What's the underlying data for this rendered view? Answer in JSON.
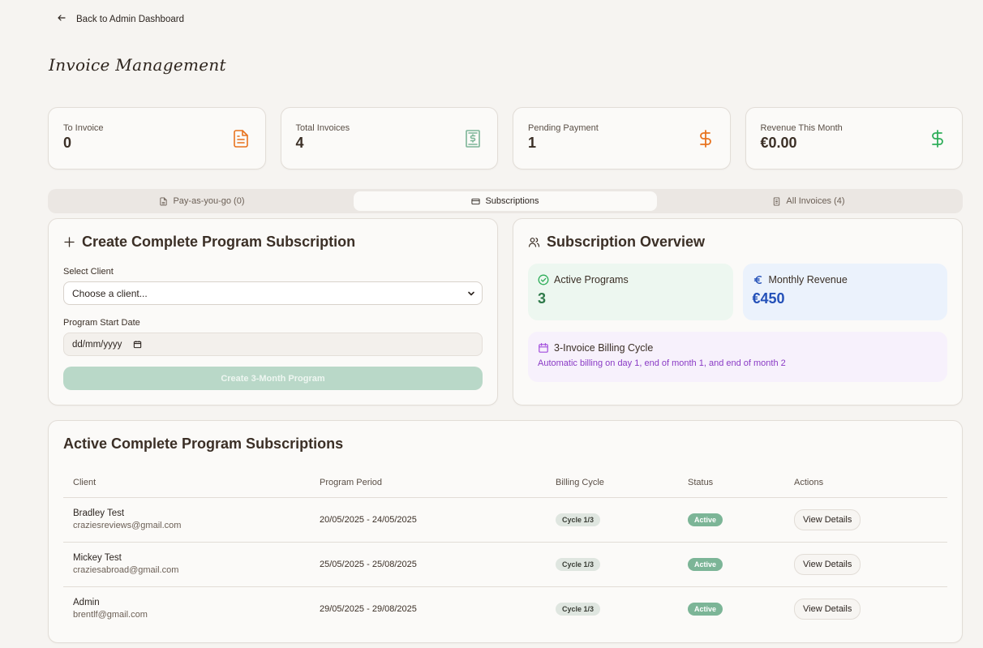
{
  "nav": {
    "back_label": "Back to Admin Dashboard"
  },
  "page": {
    "title": "Invoice Management"
  },
  "stats": [
    {
      "label": "To Invoice",
      "value": "0",
      "icon": "file-text-icon",
      "color": "#e8731e"
    },
    {
      "label": "Total Invoices",
      "value": "4",
      "icon": "receipt-icon",
      "color": "#7cb597"
    },
    {
      "label": "Pending Payment",
      "value": "1",
      "icon": "dollar-icon",
      "color": "#e8731e"
    },
    {
      "label": "Revenue This Month",
      "value": "€0.00",
      "icon": "dollar-icon",
      "color": "#2fae5a"
    }
  ],
  "tabs": [
    {
      "label": "Pay-as-you-go (0)",
      "active": false
    },
    {
      "label": "Subscriptions",
      "active": true
    },
    {
      "label": "All Invoices (4)",
      "active": false
    }
  ],
  "create_form": {
    "title": "Create Complete Program Subscription",
    "client_label": "Select Client",
    "client_placeholder": "Choose a client...",
    "date_label": "Program Start Date",
    "date_placeholder": "dd/mm/yyyy",
    "submit_label": "Create 3-Month Program"
  },
  "overview": {
    "title": "Subscription Overview",
    "active_programs_label": "Active Programs",
    "active_programs_value": "3",
    "monthly_revenue_label": "Monthly Revenue",
    "monthly_revenue_value": "€450",
    "billing_title": "3-Invoice Billing Cycle",
    "billing_desc": "Automatic billing on day 1, end of month 1, and end of month 2"
  },
  "subscriptions": {
    "title": "Active Complete Program Subscriptions",
    "columns": [
      "Client",
      "Program Period",
      "Billing Cycle",
      "Status",
      "Actions"
    ],
    "rows": [
      {
        "name": "Bradley Test",
        "email": "craziesreviews@gmail.com",
        "period": "20/05/2025 - 24/05/2025",
        "cycle": "Cycle 1/3",
        "status": "Active",
        "action": "View Details"
      },
      {
        "name": "Mickey Test",
        "email": "craziesabroad@gmail.com",
        "period": "25/05/2025 - 25/08/2025",
        "cycle": "Cycle 1/3",
        "status": "Active",
        "action": "View Details"
      },
      {
        "name": "Admin",
        "email": "brentlf@gmail.com",
        "period": "29/05/2025 - 29/08/2025",
        "cycle": "Cycle 1/3",
        "status": "Active",
        "action": "View Details"
      }
    ]
  }
}
